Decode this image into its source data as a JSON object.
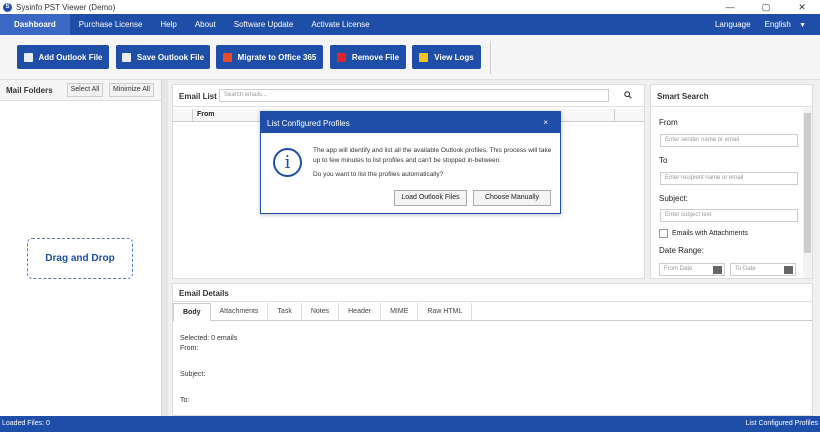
{
  "window": {
    "title": "Sysinfo PST Viewer (Demo)",
    "controls": [
      "—",
      "▢",
      "✕"
    ]
  },
  "menu": {
    "items": [
      "Dashboard",
      "Purchase License",
      "Help",
      "About",
      "Software Update",
      "Activate License"
    ],
    "language_label": "Language",
    "language_value": "English"
  },
  "toolbar": {
    "add": "Add Outlook File",
    "save": "Save Outlook File",
    "migrate": "Migrate to Office 365",
    "remove": "Remove File",
    "logs": "View Logs"
  },
  "mail_folders": {
    "title": "Mail Folders",
    "select_all": "Select All",
    "minimize_all": "Minimize All",
    "drag_drop": "Drag and Drop"
  },
  "email_list": {
    "title": "Email List",
    "search_placeholder": "Search emails...",
    "col_from": "From"
  },
  "smart_search": {
    "title": "Smart Search",
    "from_label": "From",
    "from_placeholder": "Enter sender name or email",
    "to_label": "To",
    "to_placeholder": "Enter recipient name or email",
    "subject_label": "Subject:",
    "subject_placeholder": "Enter subject text",
    "attachments_label": "Emails with Attachments",
    "date_range_label": "Date Range:",
    "from_date": "From Date",
    "to_date": "To Date"
  },
  "email_details": {
    "title": "Email Details",
    "tabs": [
      "Body",
      "Attachments",
      "Task",
      "Notes",
      "Header",
      "MIME",
      "Raw HTML"
    ],
    "selected": "Selected: 0 emails",
    "from": "From:",
    "subject": "Subject:",
    "to": "To:"
  },
  "modal": {
    "title": "List Configured Profiles",
    "close": "×",
    "message": "The app will identify and list all the available Outlook profiles. This process will take up to few minutes to list profiles and can't be stopped in-between.",
    "question": "Do you want to list the profiles automatically?",
    "load_btn": "Load Outlook Files",
    "manual_btn": "Choose Manually"
  },
  "status": {
    "left": "Loaded Files: 0",
    "right": "List Configured Profiles"
  },
  "colors": {
    "brand": "#1e4ea8",
    "migrate_icon": "#e94b2b",
    "remove_icon": "#e0242f",
    "logs_icon": "#f3c322"
  }
}
